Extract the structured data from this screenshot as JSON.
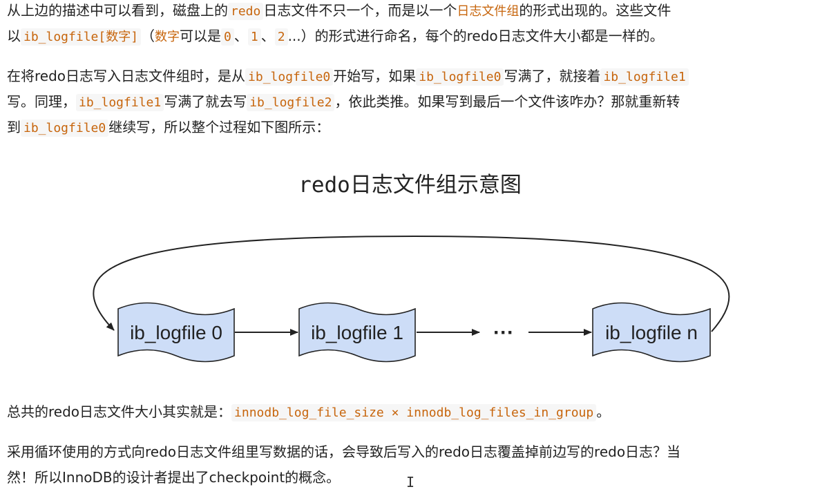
{
  "para1": {
    "l1_a": "从上边的描述中可以看到，磁盘上的",
    "l1_code1": "redo",
    "l1_b": "日志文件不只一个，而是以一个",
    "l1_hl": "日志文件组",
    "l1_c": "的形式出现的。这些文件",
    "l2_a": "以",
    "l2_code1": "ib_logfile[数字]",
    "l2_b": "（",
    "l2_hl": "数字",
    "l2_c": "可以是",
    "l2_code2": "0",
    "l2_d": "、",
    "l2_code3": "1",
    "l2_e": "、",
    "l2_code4": "2",
    "l2_f": "...）的形式进行命名，每个的redo日志文件大小都是一样的。"
  },
  "para2": {
    "l1_a": "在将redo日志写入日志文件组时，是从",
    "l1_code1": "ib_logfile0",
    "l1_b": "开始写，如果",
    "l1_code2": "ib_logfile0",
    "l1_c": "写满了，就接着",
    "l1_code3": "ib_logfile1",
    "l2_a": "写。同理，",
    "l2_code1": "ib_logfile1",
    "l2_b": "写满了就去写",
    "l2_code2": "ib_logfile2",
    "l2_c": "，依此类推。如果写到最后一个文件该咋办？那就重新转",
    "l3_a": "到",
    "l3_code1": "ib_logfile0",
    "l3_b": "继续写，所以整个过程如下图所示："
  },
  "diagram": {
    "title": "redo日志文件组示意图",
    "files": [
      "ib_logfile 0",
      "ib_logfile 1",
      "ib_logfile n"
    ],
    "ellipsis": "···",
    "file_fill": "#cdddf7",
    "stroke": "#222222"
  },
  "para3": {
    "a": "总共的redo日志文件大小其实就是：",
    "code": "innodb_log_file_size × innodb_log_files_in_group",
    "b": "。"
  },
  "para4": {
    "l1": "采用循环使用的方式向redo日志文件组里写数据的话，会导致后写入的redo日志覆盖掉前边写的redo日志？当",
    "l2": "然！所以InnoDB的设计者提出了checkpoint的概念。"
  },
  "cursor_glyph": "I",
  "colors": {
    "code_text": "#c7650c",
    "code_bg": "#f6f6f6",
    "body_text": "#222222"
  }
}
